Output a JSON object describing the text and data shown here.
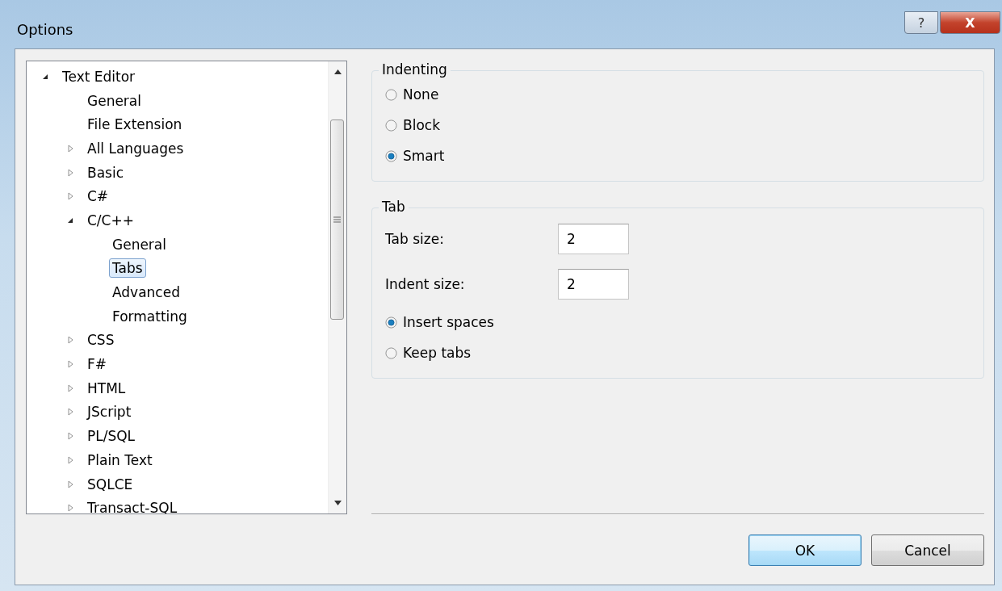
{
  "window": {
    "title": "Options",
    "buttons": [
      {
        "kind": "help",
        "label": "?"
      },
      {
        "kind": "close",
        "label": "X"
      }
    ]
  },
  "tree": [
    {
      "label": "Text Editor",
      "kind": "node",
      "expanded": true,
      "selected": false,
      "children": [
        {
          "label": "General",
          "kind": "leaf",
          "selected": false
        },
        {
          "label": "File Extension",
          "kind": "leaf",
          "selected": false
        },
        {
          "label": "All Languages",
          "kind": "node",
          "expanded": false,
          "selected": false
        },
        {
          "label": "Basic",
          "kind": "node",
          "expanded": false,
          "selected": false
        },
        {
          "label": "C#",
          "kind": "node",
          "expanded": false,
          "selected": false
        },
        {
          "label": "C/C++",
          "kind": "node",
          "expanded": true,
          "selected": false,
          "children": [
            {
              "label": "General",
              "kind": "leaf",
              "selected": false
            },
            {
              "label": "Tabs",
              "kind": "leaf",
              "selected": true
            },
            {
              "label": "Advanced",
              "kind": "leaf",
              "selected": false
            },
            {
              "label": "Formatting",
              "kind": "leaf",
              "selected": false
            }
          ]
        },
        {
          "label": "CSS",
          "kind": "node",
          "expanded": false,
          "selected": false
        },
        {
          "label": "F#",
          "kind": "node",
          "expanded": false,
          "selected": false
        },
        {
          "label": "HTML",
          "kind": "node",
          "expanded": false,
          "selected": false
        },
        {
          "label": "JScript",
          "kind": "node",
          "expanded": false,
          "selected": false
        },
        {
          "label": "PL/SQL",
          "kind": "node",
          "expanded": false,
          "selected": false
        },
        {
          "label": "Plain Text",
          "kind": "node",
          "expanded": false,
          "selected": false
        },
        {
          "label": "SQLCE",
          "kind": "node",
          "expanded": false,
          "selected": false
        },
        {
          "label": "Transact-SQL",
          "kind": "node",
          "expanded": false,
          "selected": false
        }
      ]
    }
  ],
  "groups": [
    {
      "title": "Indenting",
      "controls": [
        {
          "kind": "radio",
          "label": "None",
          "selected": false
        },
        {
          "kind": "radio",
          "label": "Block",
          "selected": false
        },
        {
          "kind": "radio",
          "label": "Smart",
          "selected": true
        }
      ]
    },
    {
      "title": "Tab",
      "controls": [
        {
          "kind": "number",
          "label": "Tab size:",
          "value": "2"
        },
        {
          "kind": "number",
          "label": "Indent size:",
          "value": "2"
        },
        {
          "kind": "radio",
          "label": "Insert spaces",
          "selected": true
        },
        {
          "kind": "radio",
          "label": "Keep tabs",
          "selected": false
        }
      ]
    }
  ],
  "buttons": [
    {
      "label": "OK",
      "default": true
    },
    {
      "label": "Cancel",
      "default": false
    }
  ]
}
